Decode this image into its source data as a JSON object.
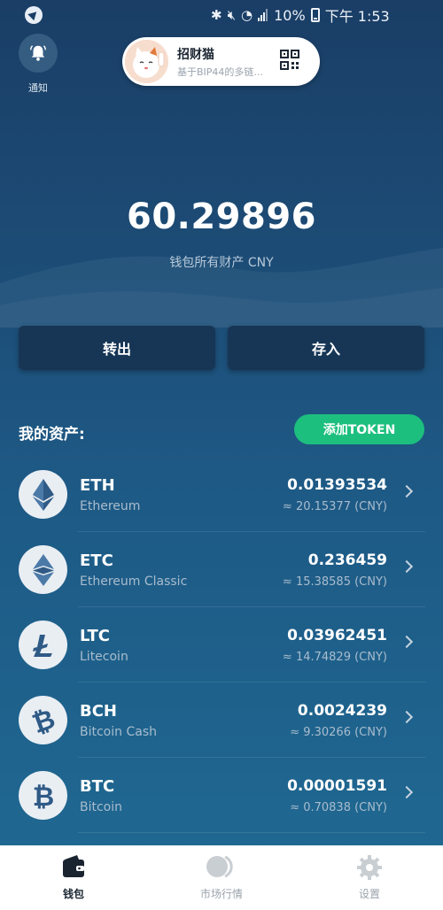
{
  "status_bar": {
    "battery": "10%",
    "time": "下午 1:53"
  },
  "header": {
    "notify_label": "通知",
    "wallet": {
      "name": "招财猫",
      "subtitle": "基于BIP44的多链..."
    }
  },
  "balance": {
    "total": "60.29896",
    "label": "钱包所有财产 CNY"
  },
  "actions": {
    "transfer_out": "转出",
    "deposit": "存入"
  },
  "assets": {
    "title": "我的资产:",
    "add_token_label": "添加TOKEN",
    "items": [
      {
        "symbol": "ETH",
        "name": "Ethereum",
        "amount": "0.01393534",
        "value": "≈ 20.15377 (CNY)",
        "icon": "ethereum-icon"
      },
      {
        "symbol": "ETC",
        "name": "Ethereum Classic",
        "amount": "0.236459",
        "value": "≈ 15.38585 (CNY)",
        "icon": "ethereum-classic-icon"
      },
      {
        "symbol": "LTC",
        "name": "Litecoin",
        "amount": "0.03962451",
        "value": "≈ 14.74829 (CNY)",
        "icon": "litecoin-icon"
      },
      {
        "symbol": "BCH",
        "name": "Bitcoin Cash",
        "amount": "0.0024239",
        "value": "≈ 9.30266 (CNY)",
        "icon": "bitcoin-cash-icon"
      },
      {
        "symbol": "BTC",
        "name": "Bitcoin",
        "amount": "0.00001591",
        "value": "≈ 0.70838 (CNY)",
        "icon": "bitcoin-icon"
      }
    ]
  },
  "bottom_nav": {
    "wallet": "钱包",
    "market": "市场行情",
    "settings": "设置"
  },
  "colors": {
    "accent_green": "#1dbf7e",
    "button_dark": "#173656"
  }
}
